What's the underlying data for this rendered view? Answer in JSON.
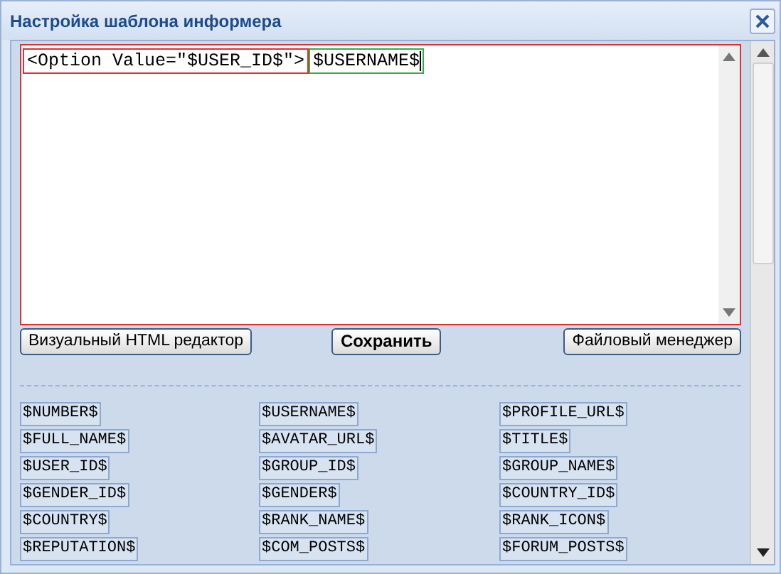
{
  "window": {
    "title": "Настройка шаблона информера"
  },
  "editor": {
    "segments": [
      {
        "text": "<Option Value=\"$USER_ID$\">",
        "color": "#e03030"
      },
      {
        "text": "$USERNAME$",
        "color": "#30b040"
      }
    ]
  },
  "buttons": [
    {
      "label": "Визуальный HTML редактор",
      "bold": false
    },
    {
      "label": "Сохранить",
      "bold": true
    },
    {
      "label": "Файловый менеджер",
      "bold": false
    }
  ],
  "variables": [
    [
      "$NUMBER$",
      "$USERNAME$",
      "$PROFILE_URL$"
    ],
    [
      "$FULL_NAME$",
      "$AVATAR_URL$",
      "$TITLE$"
    ],
    [
      "$USER_ID$",
      "$GROUP_ID$",
      "$GROUP_NAME$"
    ],
    [
      "$GENDER_ID$",
      "$GENDER$",
      "$COUNTRY_ID$"
    ],
    [
      "$COUNTRY$",
      "$RANK_NAME$",
      "$RANK_ICON$"
    ],
    [
      "$REPUTATION$",
      "$COM_POSTS$",
      "$FORUM_POSTS$"
    ]
  ]
}
